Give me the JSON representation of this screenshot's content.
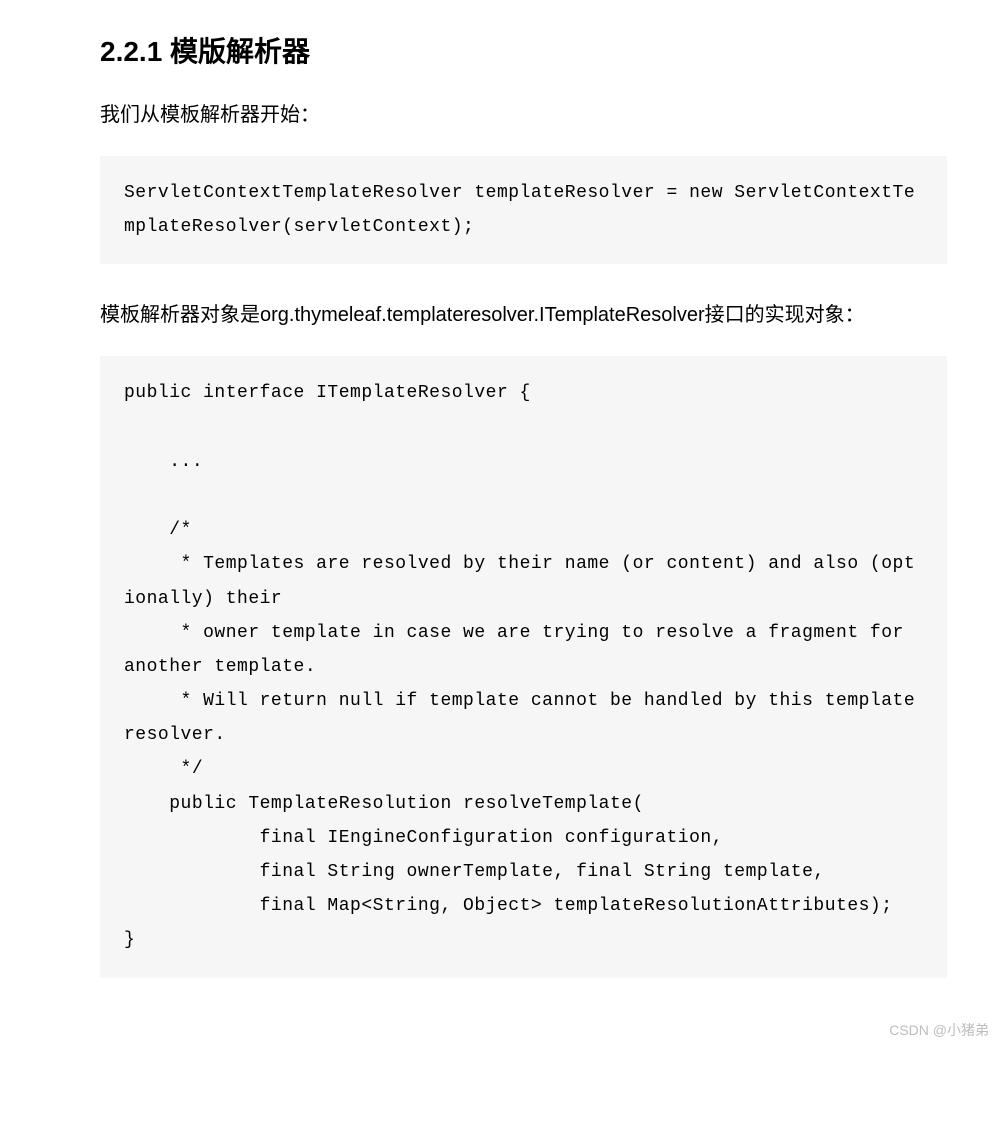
{
  "heading": "2.2.1 模版解析器",
  "para1": "我们从模板解析器开始：",
  "code1": "ServletContextTemplateResolver templateResolver = new ServletContextTemplateResolver(servletContext);",
  "para2": "模板解析器对象是org.thymeleaf.templateresolver.ITemplateResolver接口的实现对象：",
  "code2": "public interface ITemplateResolver {\n\n    ...\n  \n    /*\n     * Templates are resolved by their name (or content) and also (optionally) their\n     * owner template in case we are trying to resolve a fragment for another template.\n     * Will return null if template cannot be handled by this template resolver.\n     */\n    public TemplateResolution resolveTemplate(\n            final IEngineConfiguration configuration,\n            final String ownerTemplate, final String template,\n            final Map<String, Object> templateResolutionAttributes);\n}",
  "watermark": "CSDN @小猪弟"
}
